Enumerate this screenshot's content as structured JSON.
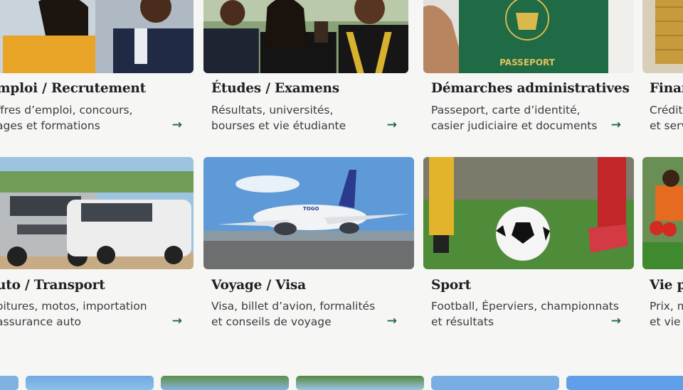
{
  "cards": [
    {
      "title": "mploi / Recrutement",
      "desc1": "ffres d’emploi, concours,",
      "desc2": "ages et formations",
      "arrow": "→"
    },
    {
      "title": "Études / Examens",
      "desc1": "Résultats, universités,",
      "desc2": "bourses et vie étudiante",
      "arrow": "→"
    },
    {
      "title": "Démarches administratives",
      "desc1": "Passeport, carte d’identité,",
      "desc2": "casier judiciaire et documents",
      "arrow": "→"
    },
    {
      "title": "Finan",
      "desc1": "Crédit,",
      "desc2": "et serv",
      "arrow": "→"
    },
    {
      "title": "uto / Transport",
      "desc1": "oitures, motos, importation",
      "desc2": "assurance auto",
      "arrow": "→"
    },
    {
      "title": "Voyage / Visa",
      "desc1": "Visa, billet d’avion, formalités",
      "desc2": "et conseils de voyage",
      "arrow": "→"
    },
    {
      "title": "Sport",
      "desc1": "Football, Éperviers, championnats",
      "desc2": "et résultats",
      "arrow": "→"
    },
    {
      "title": "Vie pr",
      "desc1": "Prix, m",
      "desc2": "et vie c",
      "arrow": "→"
    }
  ],
  "images": {
    "passport_label": "PASSEPORT",
    "plane_label": "TOGO"
  },
  "colors": {
    "accent": "#1e6b40",
    "background": "#f6f6f4"
  }
}
